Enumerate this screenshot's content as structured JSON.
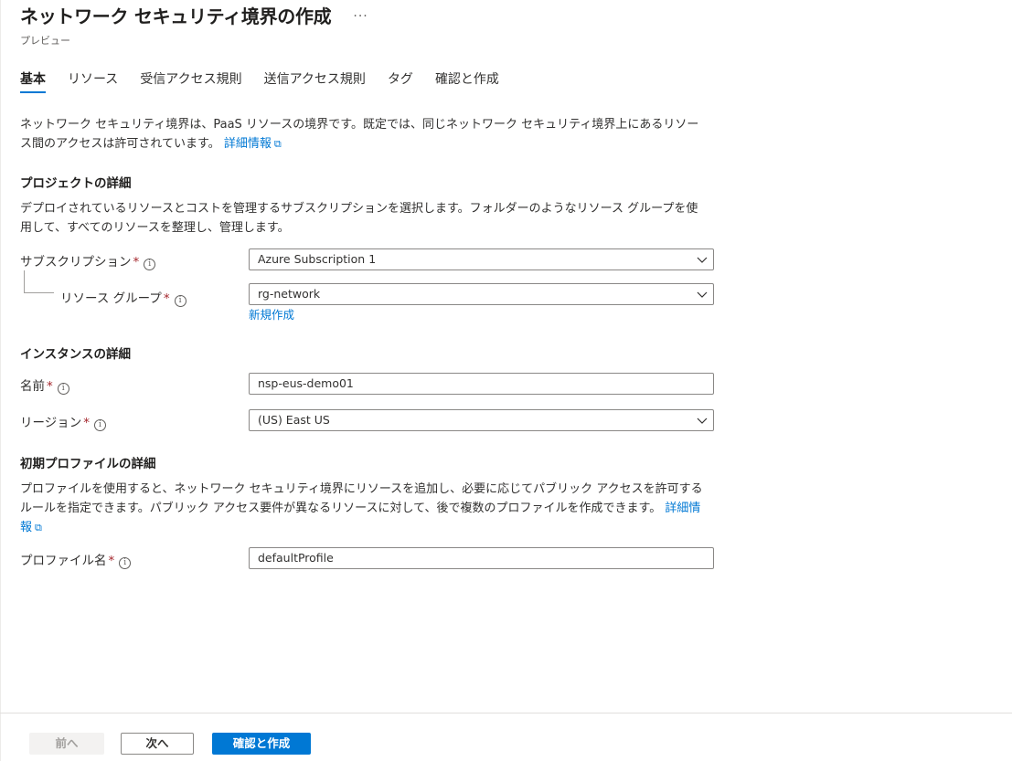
{
  "header": {
    "title": "ネットワーク セキュリティ境界の作成",
    "more": "···",
    "subtitle": "プレビュー"
  },
  "tabs": [
    {
      "label": "基本",
      "active": true
    },
    {
      "label": "リソース",
      "active": false
    },
    {
      "label": "受信アクセス規則",
      "active": false
    },
    {
      "label": "送信アクセス規則",
      "active": false
    },
    {
      "label": "タグ",
      "active": false
    },
    {
      "label": "確認と作成",
      "active": false
    }
  ],
  "intro": {
    "line1": "ネットワーク セキュリティ境界は、PaaS リソースの境界です。既定では、同じネットワーク セキュリティ境界上にあるリソー",
    "line2": "ス間のアクセスは許可されています。",
    "link": "詳細情報"
  },
  "project": {
    "heading": "プロジェクトの詳細",
    "desc_line1": "デプロイされているリソースとコストを管理するサブスクリプションを選択します。フォルダーのようなリソース グループを使",
    "desc_line2": "用して、すべてのリソースを整理し、管理します。",
    "subscription_label": "サブスクリプション",
    "subscription_value": "Azure Subscription 1",
    "resource_group_label": "リソース グループ",
    "resource_group_value": "rg-network",
    "create_new": "新規作成"
  },
  "instance": {
    "heading": "インスタンスの詳細",
    "name_label": "名前",
    "name_value": "nsp-eus-demo01",
    "region_label": "リージョン",
    "region_value": "(US) East US"
  },
  "profile": {
    "heading": "初期プロファイルの詳細",
    "desc_line1": "プロファイルを使用すると、ネットワーク セキュリティ境界にリソースを追加し、必要に応じてパブリック アクセスを許可する",
    "desc_line2": "ルールを指定できます。パブリック アクセス要件が異なるリソースに対して、後で複数のプロファイルを作成できます。",
    "link_part1": "詳細情",
    "link_part2": "報",
    "name_label": "プロファイル名",
    "name_value": "defaultProfile"
  },
  "common": {
    "required": "*",
    "info": "i"
  },
  "footer": {
    "prev": "前へ",
    "next": "次へ",
    "review": "確認と作成"
  },
  "colors": {
    "accent": "#0078d4",
    "required": "#a4262c",
    "border": "#8a8886"
  }
}
